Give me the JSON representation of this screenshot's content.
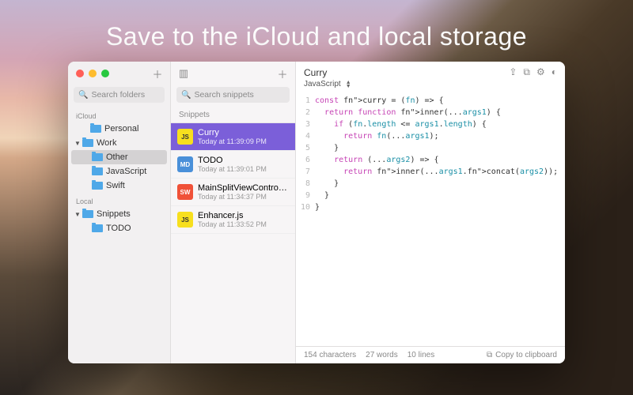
{
  "headline": "Save to the iCloud and local storage",
  "sidebar": {
    "search_placeholder": "Search folders",
    "sections": [
      {
        "label": "iCloud",
        "items": [
          {
            "name": "Personal",
            "expanded": false,
            "children": []
          },
          {
            "name": "Work",
            "expanded": true,
            "children": [
              {
                "name": "Other",
                "selected": true
              },
              {
                "name": "JavaScript"
              },
              {
                "name": "Swift"
              }
            ]
          }
        ]
      },
      {
        "label": "Local",
        "items": [
          {
            "name": "Snippets",
            "expanded": true,
            "children": [
              {
                "name": "TODO"
              }
            ]
          }
        ]
      }
    ]
  },
  "snippets": {
    "search_placeholder": "Search snippets",
    "header": "Snippets",
    "items": [
      {
        "title": "Curry",
        "time": "Today at 11:39:09 PM",
        "lang": "js",
        "badge": "JS",
        "selected": true
      },
      {
        "title": "TODO",
        "time": "Today at 11:39:01 PM",
        "lang": "md",
        "badge": "MD"
      },
      {
        "title": "MainSplitViewController",
        "time": "Today at 11:34:37 PM",
        "lang": "sw",
        "badge": "SW"
      },
      {
        "title": "Enhancer.js",
        "time": "Today at 11:33:52 PM",
        "lang": "js",
        "badge": "JS"
      }
    ]
  },
  "editor": {
    "title": "Curry",
    "language": "JavaScript",
    "code_lines": [
      "const curry = (fn) => {",
      "  return function inner(...args1) {",
      "    if (fn.length <= args1.length) {",
      "      return fn(...args1);",
      "    }",
      "    return (...args2) => {",
      "      return inner(...args1.concat(args2));",
      "    }",
      "  }",
      "}"
    ]
  },
  "status": {
    "chars": "154 characters",
    "words": "27 words",
    "lines": "10 lines",
    "copy": "Copy to clipboard"
  }
}
